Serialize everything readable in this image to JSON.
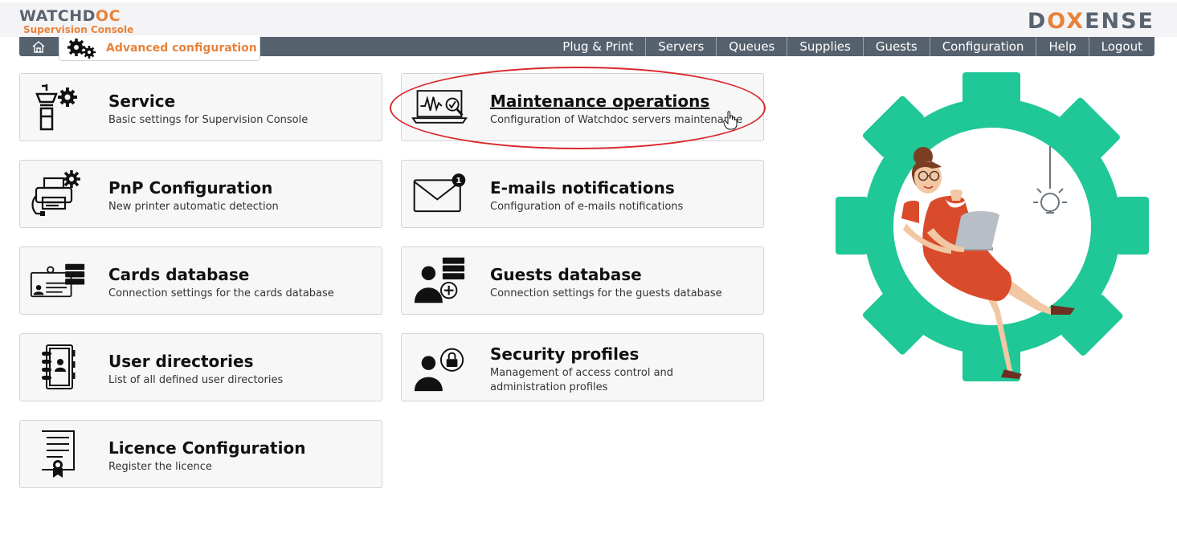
{
  "header": {
    "logo_watchd": "WATCHD",
    "logo_oc": "OC",
    "logo_subtitle": "Supervision Console",
    "brand_d": "D",
    "brand_ox": "OX",
    "brand_ense": "ENSE"
  },
  "nav": {
    "home_icon": "home-icon",
    "active_tab": "Advanced configuration",
    "items": [
      "Plug & Print",
      "Servers",
      "Queues",
      "Supplies",
      "Guests",
      "Configuration",
      "Help",
      "Logout"
    ]
  },
  "cards": [
    {
      "title": "Service",
      "desc": "Basic settings for Supervision Console",
      "icon": "control-tower-gear-icon"
    },
    {
      "title": "Maintenance operations",
      "desc": "Configuration of Watchdoc servers maintenance",
      "icon": "laptop-monitoring-icon"
    },
    {
      "title": "PnP Configuration",
      "desc": "New printer automatic detection",
      "icon": "printer-gear-icon"
    },
    {
      "title": "E-mails notifications",
      "desc": "Configuration of e-mails notifications",
      "icon": "envelope-badge-icon",
      "badge": "1"
    },
    {
      "title": "Cards database",
      "desc": "Connection settings for the cards database",
      "icon": "id-card-database-icon"
    },
    {
      "title": "Guests database",
      "desc": "Connection settings for the guests database",
      "icon": "user-add-database-icon"
    },
    {
      "title": "User directories",
      "desc": "List of all defined user directories",
      "icon": "address-book-icon"
    },
    {
      "title": "Security profiles",
      "desc": "Management of access control and administration profiles",
      "icon": "user-lock-icon"
    },
    {
      "title": "Licence Configuration",
      "desc": "Register the licence",
      "icon": "certificate-icon"
    }
  ],
  "colors": {
    "accent_orange": "#e8823a",
    "nav_bg": "#56616e",
    "gear_green": "#1fc896",
    "highlight_red": "#d9262c"
  }
}
